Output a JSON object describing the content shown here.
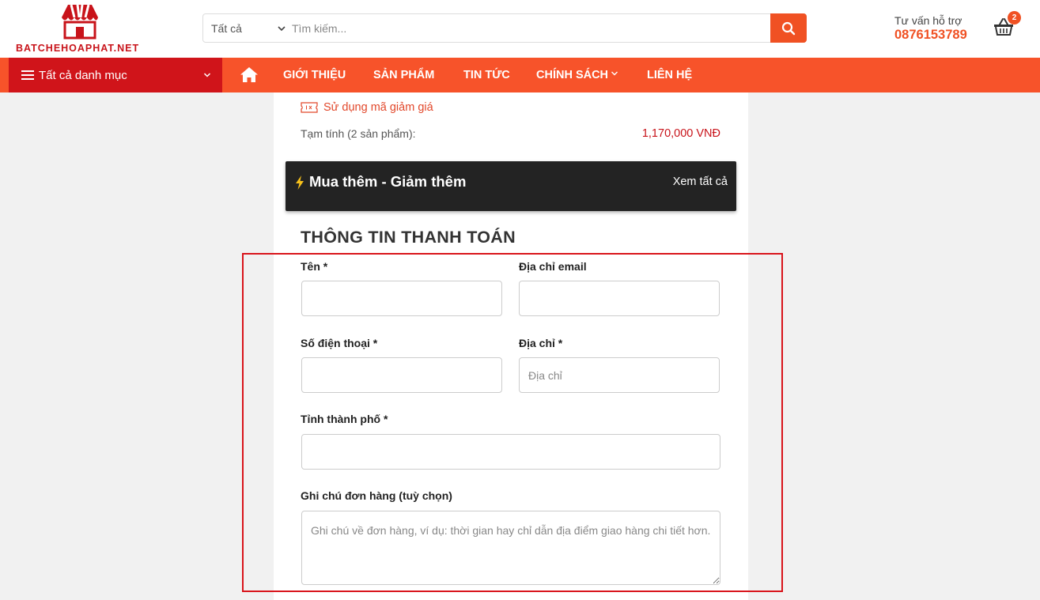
{
  "header": {
    "logo_text": "BATCHEHOAPHAT.NET",
    "search": {
      "category": "Tất cả",
      "placeholder": "Tìm kiếm..."
    },
    "support_label": "Tư vấn hỗ trợ",
    "support_phone": "0876153789",
    "cart_count": "2"
  },
  "nav": {
    "all_categories": "Tất cả danh mục",
    "items": [
      {
        "label": "GIỚI THIỆU"
      },
      {
        "label": "SẢN PHẨM"
      },
      {
        "label": "TIN TỨC"
      },
      {
        "label": "CHÍNH SÁCH"
      },
      {
        "label": "LIÊN HỆ"
      }
    ]
  },
  "cart_summary": {
    "coupon_label": "Sử dụng mã giảm giá",
    "subtotal_label": "Tạm tính (2 sản phẩm):",
    "subtotal_value": "1,170,000 VNĐ"
  },
  "upsell": {
    "title": "Mua thêm - Giảm thêm",
    "link": "Xem tất cả"
  },
  "billing": {
    "title": "THÔNG TIN THANH TOÁN",
    "name_label": "Tên *",
    "email_label": "Địa chỉ email",
    "phone_label": "Số điện thoại *",
    "address_label": "Địa chỉ *",
    "address_placeholder": "Địa chỉ",
    "city_label": "Tỉnh thành phố *",
    "note_label": "Ghi chú đơn hàng (tuỳ chọn)",
    "note_placeholder": "Ghi chú về đơn hàng, ví dụ: thời gian hay chỉ dẫn địa điểm giao hàng chi tiết hơn."
  },
  "colors": {
    "brand_orange": "#f05123",
    "brand_red": "#d0141a",
    "highlight": "#d9141b"
  }
}
